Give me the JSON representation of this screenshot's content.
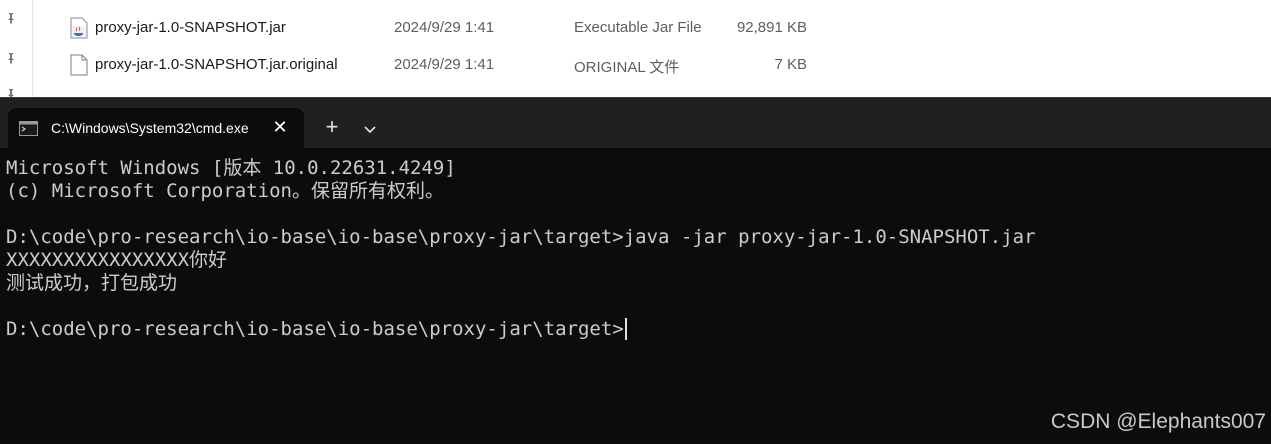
{
  "explorer": {
    "files": [
      {
        "name": "proxy-jar-1.0-SNAPSHOT.jar",
        "date": "2024/9/29 1:41",
        "type": "Executable Jar File",
        "size": "92,891 KB",
        "icon": "java-jar-icon"
      },
      {
        "name": "proxy-jar-1.0-SNAPSHOT.jar.original",
        "date": "2024/9/29 1:41",
        "type": "ORIGINAL 文件",
        "size": "7 KB",
        "icon": "blank-file-icon"
      }
    ]
  },
  "terminal": {
    "tab_title": "C:\\Windows\\System32\\cmd.exe",
    "close_glyph": "✕",
    "new_tab_glyph": "+",
    "lines": [
      "Microsoft Windows [版本 10.0.22631.4249]",
      "(c) Microsoft Corporation。保留所有权利。",
      "",
      "D:\\code\\pro-research\\io-base\\io-base\\proxy-jar\\target>java -jar proxy-jar-1.0-SNAPSHOT.jar",
      "XXXXXXXXXXXXXXXX你好",
      "测试成功，打包成功",
      "",
      "D:\\code\\pro-research\\io-base\\io-base\\proxy-jar\\target>"
    ]
  },
  "watermark": "CSDN @Elephants007"
}
